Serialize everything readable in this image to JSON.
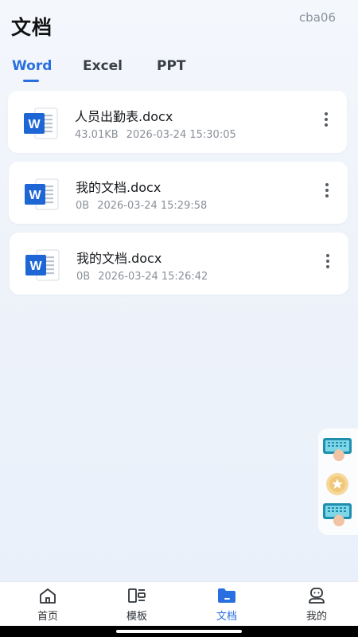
{
  "header": {
    "title": "文档",
    "username": "cba06"
  },
  "tabs": [
    {
      "label": "Word",
      "active": true
    },
    {
      "label": "Excel",
      "active": false
    },
    {
      "label": "PPT",
      "active": false
    }
  ],
  "documents": [
    {
      "name": "人员出勤表.docx",
      "size": "43.01KB",
      "modified": "2026-03-24 15:30:05",
      "icon": "word-doc-icon"
    },
    {
      "name": "我的文档.docx",
      "size": "0B",
      "modified": "2026-03-24 15:29:58",
      "icon": "word-doc-icon"
    },
    {
      "name": "我的文档.docx",
      "size": "0B",
      "modified": "2026-03-24 15:26:42",
      "icon": "word-doc-icon"
    }
  ],
  "floating_actions": [
    "keyboard-touch-icon",
    "star-coin-icon",
    "keyboard-touch-icon"
  ],
  "tabbar": [
    {
      "label": "首页",
      "icon": "home-icon",
      "active": false
    },
    {
      "label": "模板",
      "icon": "template-icon",
      "active": false
    },
    {
      "label": "文档",
      "icon": "folder-icon",
      "active": true
    },
    {
      "label": "我的",
      "icon": "profile-icon",
      "active": false
    }
  ],
  "colors": {
    "accent": "#2a6fe0",
    "word_blue": "#1e66d6",
    "background": "#eef3fa",
    "card": "#ffffff"
  }
}
